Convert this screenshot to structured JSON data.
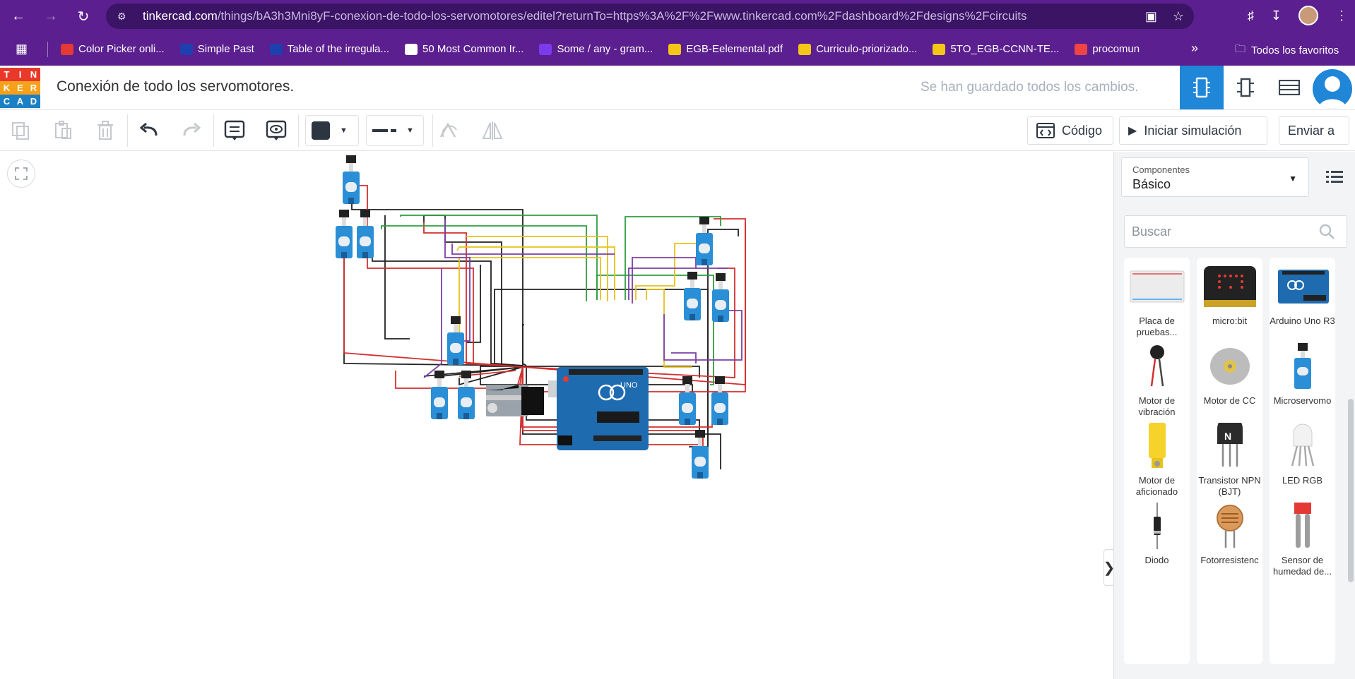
{
  "browser": {
    "url_host": "tinkercad.com",
    "url_path": "/things/bA3h3Mni8yF-conexion-de-todo-los-servomotores/editel?returnTo=https%3A%2F%2Fwww.tinkercad.com%2Fdashboard%2Fdesigns%2Fcircuits",
    "bookmarks": [
      {
        "label": "Color Picker onli...",
        "color": "#e53935"
      },
      {
        "label": "Simple Past",
        "color": "#1e40af"
      },
      {
        "label": "Table of the irregula...",
        "color": "#1e40af"
      },
      {
        "label": "50 Most Common Ir...",
        "color": "#ffffff"
      },
      {
        "label": "Some / any - gram...",
        "color": "#7c3aed"
      },
      {
        "label": "EGB-Eelemental.pdf",
        "color": "#f5c518"
      },
      {
        "label": "Curriculo-priorizado...",
        "color": "#f5c518"
      },
      {
        "label": "5TO_EGB-CCNN-TE...",
        "color": "#f5c518"
      },
      {
        "label": "procomun",
        "color": "#ef4444"
      }
    ],
    "all_favorites": "Todos los favoritos"
  },
  "header": {
    "title": "Conexión de todo los servomotores.",
    "save_status": "Se han guardado todos los cambios.",
    "logo_letters": [
      "T",
      "I",
      "N",
      "K",
      "E",
      "R",
      "C",
      "A",
      "D"
    ],
    "logo_colors": [
      "#e8392b",
      "#e8392b",
      "#e8392b",
      "#f7a11b",
      "#f7a11b",
      "#f7a11b",
      "#1c80c4",
      "#1c80c4",
      "#1c80c4"
    ]
  },
  "toolbar": {
    "code_label": "Código",
    "simulate_label": "Iniciar simulación",
    "send_label": "Enviar a"
  },
  "panel": {
    "components_label": "Componentes",
    "components_value": "Básico",
    "search_placeholder": "Buscar",
    "items": [
      {
        "label": "Placa de pruebas...",
        "icon": "breadboard-icon"
      },
      {
        "label": "micro:bit",
        "icon": "microbit-icon"
      },
      {
        "label": "Arduino Uno R3",
        "icon": "arduino-icon"
      },
      {
        "label": "Motor de vibración",
        "icon": "vibration-motor-icon"
      },
      {
        "label": "Motor de CC",
        "icon": "dc-motor-icon"
      },
      {
        "label": "Microservomo",
        "icon": "microservo-icon"
      },
      {
        "label": "Motor de aficionado",
        "icon": "hobby-motor-icon"
      },
      {
        "label": "Transistor NPN (BJT)",
        "icon": "transistor-icon"
      },
      {
        "label": "LED RGB",
        "icon": "rgb-led-icon"
      },
      {
        "label": "Diodo",
        "icon": "diode-icon"
      },
      {
        "label": "Fotorresistenc",
        "icon": "photoresistor-icon"
      },
      {
        "label": "Sensor de humedad de...",
        "icon": "moisture-sensor-icon"
      }
    ]
  },
  "canvas": {
    "arduino_brand": "UNO"
  }
}
